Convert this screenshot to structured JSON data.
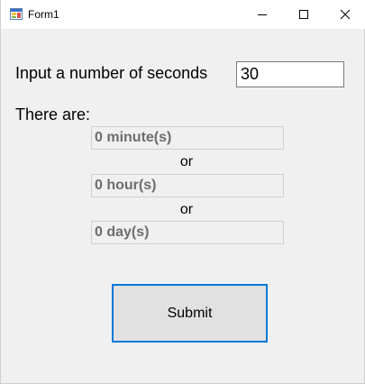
{
  "window": {
    "title": "Form1"
  },
  "form": {
    "prompt_label": "Input a number of seconds",
    "seconds_value": "30",
    "there_are_label": "There are:",
    "minutes_value": "0 minute(s)",
    "or_label_1": "or",
    "hours_value": "0 hour(s)",
    "or_label_2": "or",
    "days_value": "0 day(s)",
    "submit_label": "Submit"
  }
}
